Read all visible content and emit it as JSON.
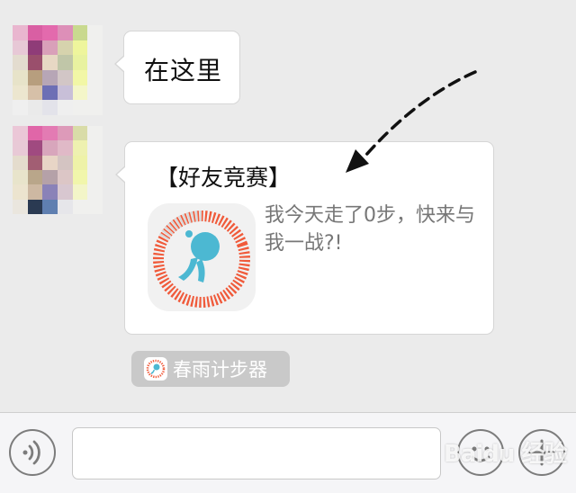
{
  "messages": [
    {
      "type": "text",
      "text": "在这里"
    },
    {
      "type": "link-card",
      "title": "【好友竞赛】",
      "description": "我今天走了0步，快来与我一战?!",
      "source_app": "春雨计步器"
    }
  ],
  "input_bar": {
    "voice_icon": "voice-icon",
    "emoji_icon": "emoji-icon",
    "add_icon": "plus-icon",
    "message_value": ""
  },
  "watermark": "Baidu 经验",
  "colors": {
    "background": "#ebebeb",
    "bubble": "#ffffff",
    "ring_orange": "#f05a3a",
    "runner_blue": "#4cb8d2"
  }
}
